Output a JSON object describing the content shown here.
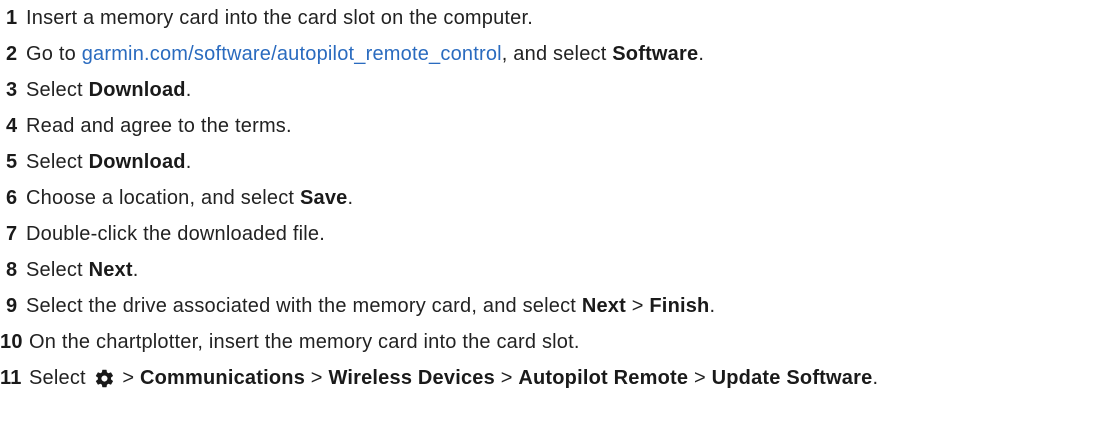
{
  "steps": [
    {
      "num": "1",
      "text": "Insert a memory card into the card slot on the computer."
    },
    {
      "num": "2",
      "prefix": "Go to ",
      "link": "garmin.com/software/autopilot_remote_control",
      "middle": ", and select ",
      "bold": "Software",
      "suffix": "."
    },
    {
      "num": "3",
      "prefix": "Select ",
      "bold": "Download",
      "suffix": "."
    },
    {
      "num": "4",
      "text": "Read and agree to the terms."
    },
    {
      "num": "5",
      "prefix": "Select ",
      "bold": "Download",
      "suffix": "."
    },
    {
      "num": "6",
      "prefix": "Choose a location, and select ",
      "bold": "Save",
      "suffix": "."
    },
    {
      "num": "7",
      "text": "Double-click the downloaded file."
    },
    {
      "num": "8",
      "prefix": "Select ",
      "bold": "Next",
      "suffix": "."
    },
    {
      "num": "9",
      "prefix": "Select the drive associated with the memory card, and select ",
      "bold1": "Next",
      "sep": " > ",
      "bold2": "Finish",
      "suffix": "."
    },
    {
      "num": "10",
      "text": "On the chartplotter, insert the memory card into the card slot."
    },
    {
      "num": "11",
      "prefix": "Select ",
      "icon": "gear-icon",
      "sep": " > ",
      "path": [
        "Communications",
        "Wireless Devices",
        "Autopilot Remote",
        "Update Software"
      ],
      "suffix": "."
    }
  ],
  "colors": {
    "text": "#222222",
    "link": "#2a6bbf"
  }
}
